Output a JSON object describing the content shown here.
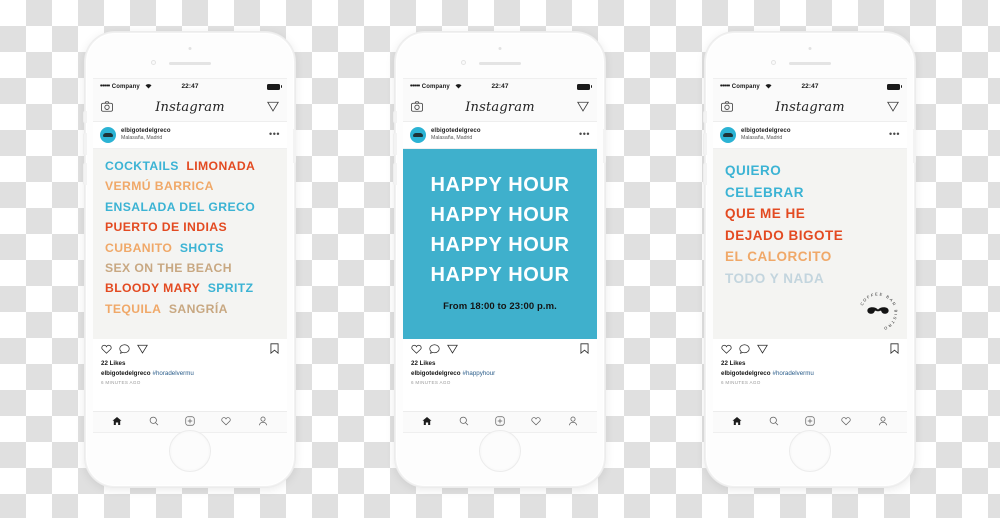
{
  "background": {
    "type": "transparency-checkerboard",
    "light": "#ffffff",
    "dark": "#e0e0e0"
  },
  "palette": {
    "cyan": "#3bb3d4",
    "orange_light": "#f0a868",
    "red_orange": "#e34a21",
    "tan": "#c8a882",
    "pale_blue": "#c3d5de",
    "happy_bg": "#3fb0cc",
    "canvas_bg": "#f4f4f2",
    "tag_blue": "#2b5d8a"
  },
  "status_bar": {
    "signal_dots": "•••••",
    "carrier": "Company",
    "wifi_icon": "wifi-icon",
    "time": "22:47",
    "battery_icon": "battery-icon"
  },
  "ig_nav": {
    "camera_icon": "camera-icon",
    "logo": "Instagram",
    "direct_icon": "direct-share-icon"
  },
  "user": {
    "avatar": "avatar-elbigotedelgreco",
    "username": "elbigotedelgreco",
    "location": "Malasaña, Madrid",
    "more_icon": "•••"
  },
  "actions": {
    "like_icon": "heart-icon",
    "comment_icon": "comment-icon",
    "share_icon": "share-icon",
    "bookmark_icon": "bookmark-icon"
  },
  "tabbar": {
    "home_icon": "home-icon",
    "search_icon": "search-icon",
    "add_icon": "add-post-icon",
    "activity_icon": "heart-icon",
    "profile_icon": "profile-icon"
  },
  "posts": [
    {
      "id": "post-cocktails-menu",
      "likes": "22 Likes",
      "username": "elbigotedelgreco",
      "hashtag": "#horadelvermu",
      "timestamp": "6 MINUTES AGO",
      "canvas_bg": "#f4f4f2",
      "lines": [
        [
          {
            "text": "COCKTAILS",
            "color": "#3bb3d4"
          },
          {
            "text": "LIMONADA",
            "color": "#e34a21"
          }
        ],
        [
          {
            "text": "VERMÚ BARRICA",
            "color": "#f0a868"
          }
        ],
        [
          {
            "text": "ENSALADA DEL GRECO",
            "color": "#3bb3d4"
          }
        ],
        [
          {
            "text": "PUERTO DE INDIAS",
            "color": "#e34a21"
          }
        ],
        [
          {
            "text": "CUBANITO",
            "color": "#f0a868"
          },
          {
            "text": "SHOTS",
            "color": "#3bb3d4"
          }
        ],
        [
          {
            "text": "SEX ON THE BEACH",
            "color": "#c8a882"
          }
        ],
        [
          {
            "text": "BLOODY MARY",
            "color": "#e34a21"
          },
          {
            "text": "SPRITZ",
            "color": "#3bb3d4"
          }
        ],
        [
          {
            "text": "TEQUILA",
            "color": "#f0a868"
          },
          {
            "text": "SANGRÍA",
            "color": "#c8a882"
          }
        ]
      ]
    },
    {
      "id": "post-happy-hour",
      "likes": "22 Likes",
      "username": "elbigotedelgreco",
      "hashtag": "#happyhour",
      "timestamp": "6 MINUTES AGO",
      "canvas_bg": "#3fb0cc",
      "headlines": [
        "HAPPY HOUR",
        "HAPPY HOUR",
        "HAPPY HOUR",
        "HAPPY HOUR"
      ],
      "subline": "From 18:00 to 23:00 p.m."
    },
    {
      "id": "post-quiero-celebrar",
      "likes": "22 Likes",
      "username": "elbigotedelgreco",
      "hashtag": "#horadelvermu",
      "timestamp": "6 MINUTES AGO",
      "canvas_bg": "#f4f4f2",
      "lines": [
        [
          {
            "text": "QUIERO",
            "color": "#3bb3d4"
          }
        ],
        [
          {
            "text": "CELEBRAR",
            "color": "#3bb3d4"
          }
        ],
        [
          {
            "text": "QUE ME HE",
            "color": "#e34a21"
          }
        ],
        [
          {
            "text": "DEJADO BIGOTE",
            "color": "#e34a21"
          }
        ],
        [
          {
            "text": "EL CALORCITO",
            "color": "#f0a868"
          }
        ],
        [
          {
            "text": "TODO Y NADA",
            "color": "#c3d5de"
          }
        ]
      ],
      "badge": {
        "icon": "mustache-logo-icon",
        "ring_text": "COFFEE  BAR  BISTRO"
      }
    }
  ]
}
